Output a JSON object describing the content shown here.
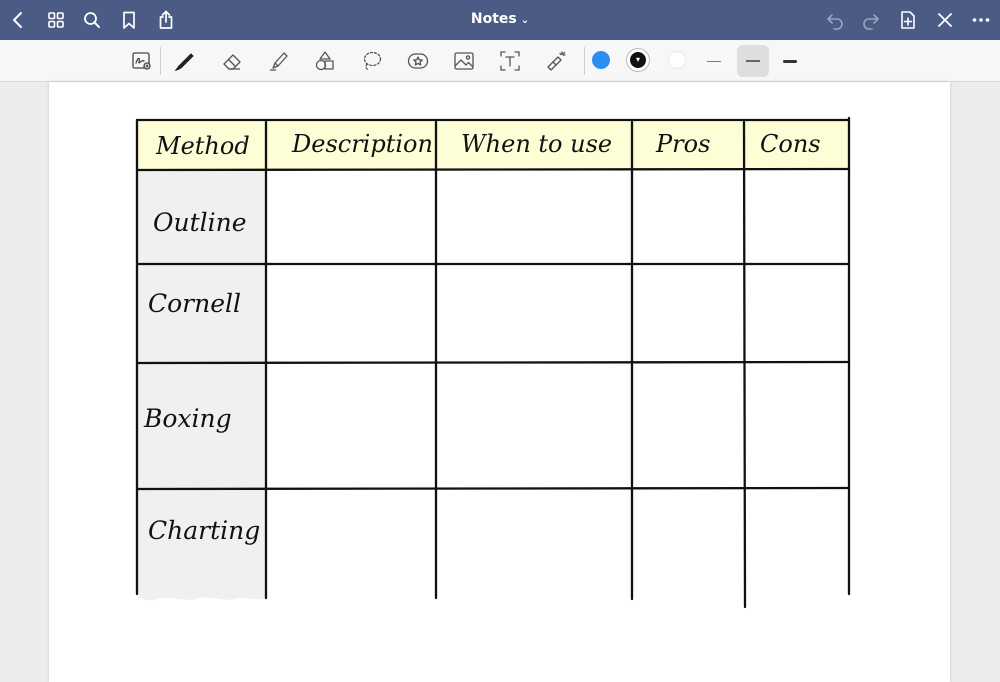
{
  "app": {
    "title": "Notes"
  },
  "navbar": {
    "left": [
      {
        "name": "back-button",
        "icon": "chevron-left-icon"
      },
      {
        "name": "grid-button",
        "icon": "grid-icon"
      },
      {
        "name": "search-button",
        "icon": "search-icon"
      },
      {
        "name": "bookmark-button",
        "icon": "bookmark-icon"
      },
      {
        "name": "share-button",
        "icon": "share-icon"
      }
    ],
    "right": [
      {
        "name": "undo-button",
        "icon": "undo-icon"
      },
      {
        "name": "redo-button",
        "icon": "redo-icon"
      },
      {
        "name": "add-page-button",
        "icon": "add-page-icon"
      },
      {
        "name": "close-toolbar-button",
        "icon": "close-icon"
      },
      {
        "name": "more-button",
        "icon": "more-icon"
      }
    ]
  },
  "toolbar": {
    "tools": [
      "scan-icon",
      "pen-icon",
      "eraser-icon",
      "highlighter-icon",
      "shapes-icon",
      "lasso-icon",
      "sticker-icon",
      "image-icon",
      "text-icon",
      "laser-pointer-icon"
    ],
    "colors": [
      "#2a8ff0",
      "#111111",
      "#ffffff"
    ],
    "selected_color": "#111111",
    "strokes": [
      "thin",
      "medium",
      "thick"
    ],
    "selected_stroke": "medium"
  },
  "table": {
    "headers": [
      "Method",
      "Description",
      "When to use",
      "Pros",
      "Cons"
    ],
    "rows": [
      "Outline",
      "Cornell",
      "Boxing",
      "Charting"
    ],
    "header_bg": "#fefed6",
    "label_bg": "#f0f0f0"
  }
}
